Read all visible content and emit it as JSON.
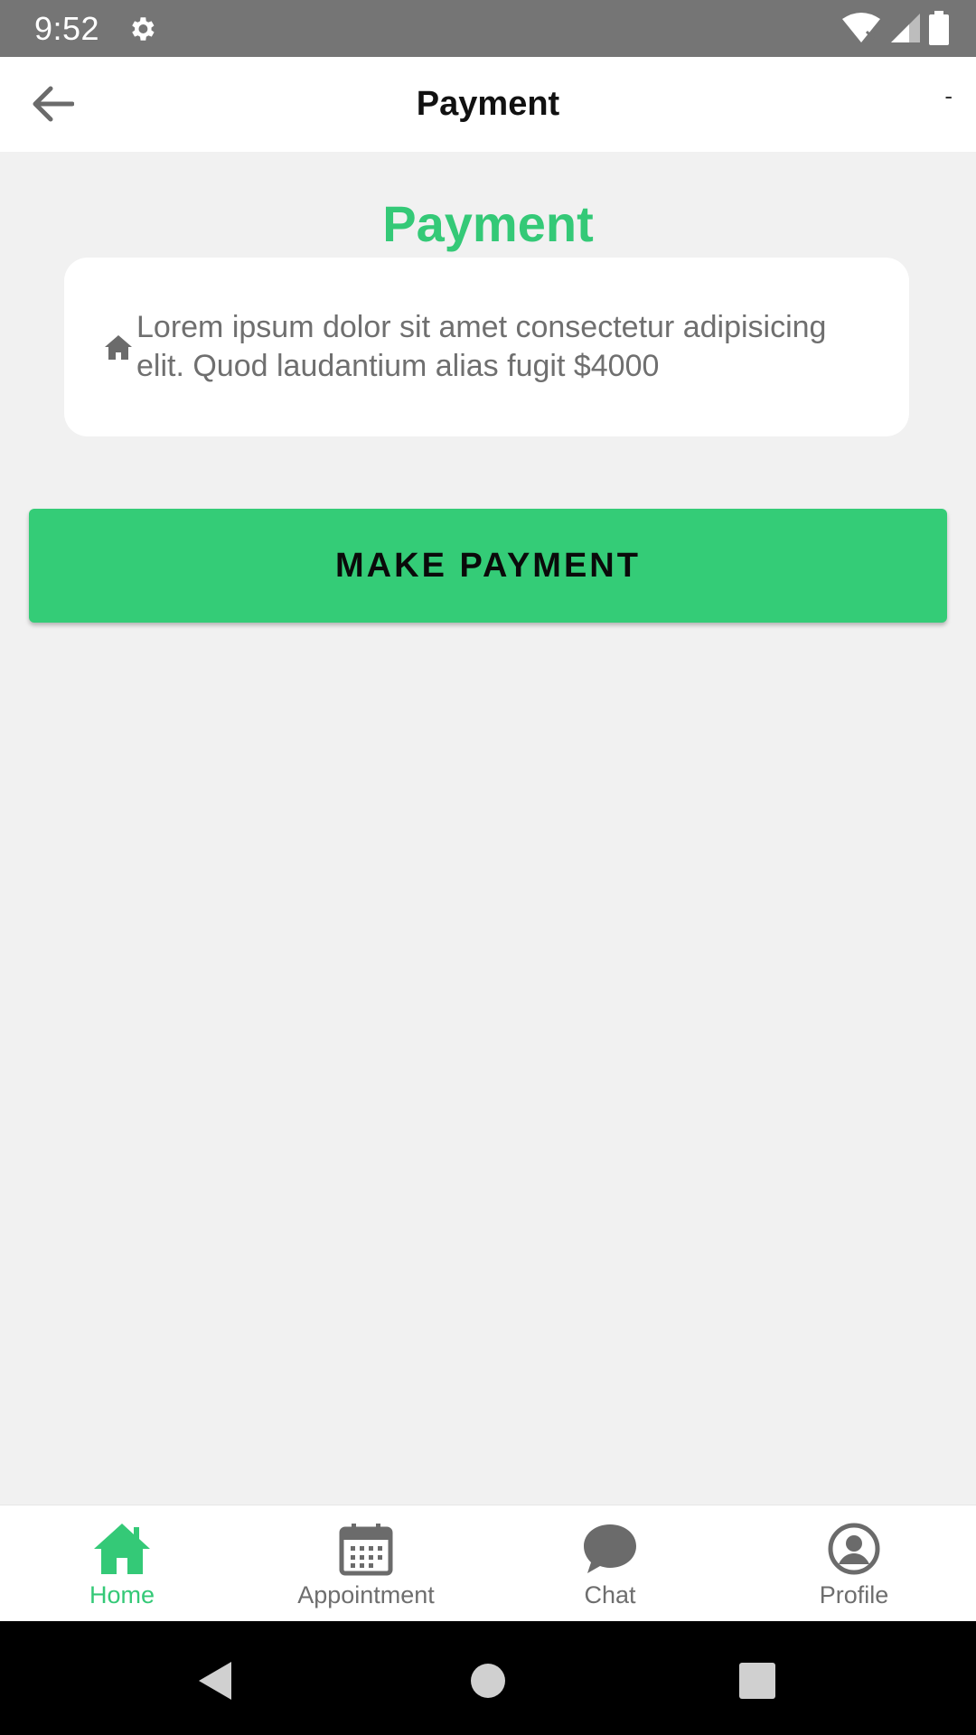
{
  "status_bar": {
    "time": "9:52",
    "icons": [
      "gear-icon",
      "wifi-icon",
      "signal-icon",
      "battery-icon"
    ]
  },
  "app_bar": {
    "title": "Payment",
    "action": "-"
  },
  "main": {
    "heading": "Payment",
    "card": {
      "icon": "home-icon",
      "text": "Lorem ipsum dolor sit amet consectetur adipisicing elit. Quod laudantium alias fugit $4000"
    },
    "make_payment_label": "MAKE PAYMENT"
  },
  "bottom_nav": {
    "items": [
      {
        "label": "Home",
        "icon": "home-icon",
        "active": true
      },
      {
        "label": "Appointment",
        "icon": "calendar-icon",
        "active": false
      },
      {
        "label": "Chat",
        "icon": "chat-bubble-icon",
        "active": false
      },
      {
        "label": "Profile",
        "icon": "profile-icon",
        "active": false
      }
    ]
  },
  "colors": {
    "accent": "#34cc77",
    "status_bar": "#757575",
    "background": "#f1f1f1",
    "nav_inactive": "#6e6e6e"
  }
}
